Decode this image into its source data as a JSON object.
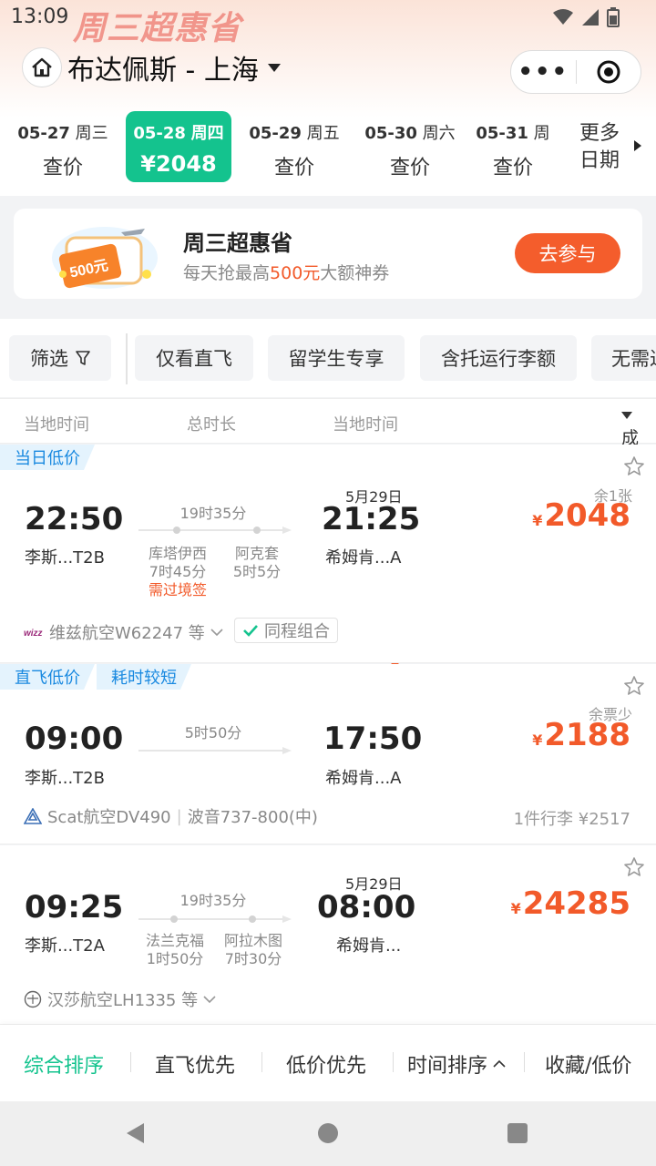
{
  "status": {
    "time": "13:09"
  },
  "header": {
    "promo_logo": "周三超惠省",
    "route_title": "布达佩斯 - 上海",
    "capsule_more": "•••"
  },
  "dates": [
    {
      "date": "05-27",
      "weekday": "周三",
      "price": "查价",
      "active": false
    },
    {
      "date": "05-28",
      "weekday": "周四",
      "price": "¥2048",
      "active": true
    },
    {
      "date": "05-29",
      "weekday": "周五",
      "price": "查价",
      "active": false
    },
    {
      "date": "05-30",
      "weekday": "周六",
      "price": "查价",
      "active": false
    },
    {
      "date": "05-31",
      "weekday": "周",
      "price": "查价",
      "active": false
    }
  ],
  "more_dates": {
    "line1": "更多",
    "line2": "日期"
  },
  "banner": {
    "title": "周三超惠省",
    "sub_prefix": "每天抢最高",
    "sub_highlight": "500元",
    "sub_suffix": "大额神券",
    "coupon_label": "500元",
    "button": "去参与"
  },
  "filters": {
    "filter": "筛选",
    "direct_only": "仅看直飞",
    "students": "留学生专享",
    "checked_baggage": "含托运行李额",
    "more": "无需过"
  },
  "columns": {
    "dep_time": "当地时间",
    "duration": "总时长",
    "arr_time": "当地时间",
    "sort": "成人含税价"
  },
  "flights": [
    {
      "tags": [
        "当日低价"
      ],
      "dep_time": "22:50",
      "dep_airport": "李斯...T2B",
      "duration": "19时35分",
      "arr_date": "5月29日",
      "arr_time": "21:25",
      "arr_airport": "希姆肯...A",
      "stops": [
        {
          "city": "库塔伊西",
          "time": "7时45分",
          "note": "需过境签"
        },
        {
          "city": "阿克套",
          "time": "5时5分"
        }
      ],
      "remain": "余1张",
      "currency": "¥",
      "price": "2048",
      "airline": "维兹航空W62247 等",
      "combo": "同程组合"
    },
    {
      "tags": [
        "直飞低价",
        "耗时较短"
      ],
      "dep_time": "09:00",
      "dep_airport": "李斯...T2B",
      "duration": "5时50分",
      "arr_time": "17:50",
      "arr_airport": "希姆肯...A",
      "remain": "余票少",
      "currency": "¥",
      "price": "2188",
      "airline": "Scat航空DV490",
      "aircraft": "波音737-800(中)",
      "baggage": "1件行李 ¥2517"
    },
    {
      "dep_time": "09:25",
      "dep_airport": "李斯...T2A",
      "duration": "19时35分",
      "arr_date": "5月29日",
      "arr_time": "08:00",
      "arr_airport": "希姆肯...",
      "stops": [
        {
          "city": "法兰克福",
          "time": "1时50分"
        },
        {
          "city": "阿拉木图",
          "time": "7时30分"
        }
      ],
      "currency": "¥",
      "price": "24285",
      "airline": "汉莎航空LH1335 等"
    }
  ],
  "sortbar": {
    "overall": "综合排序",
    "direct": "直飞优先",
    "lowprice": "低价优先",
    "time": "时间排序",
    "fav": "收藏/低价"
  },
  "colors": {
    "accent": "#14c38e",
    "price": "#f25a2a",
    "tag_blue": "#1989e0"
  }
}
